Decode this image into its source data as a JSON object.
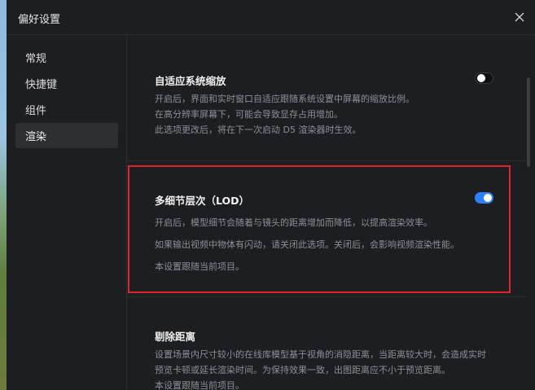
{
  "window": {
    "title": "偏好设置"
  },
  "sidebar": {
    "items": [
      {
        "label": "常规"
      },
      {
        "label": "快捷键"
      },
      {
        "label": "组件"
      },
      {
        "label": "渲染"
      }
    ]
  },
  "sections": {
    "adaptive_scaling": {
      "title": "自适应系统缩放",
      "desc": [
        "开启后，界面和实时窗口自适应跟随系统设置中屏幕的缩放比例。",
        "在高分辨率屏幕下，可能会导致显存占用增加。",
        "此选项更改后，将在下一次启动 D5 渲染器时生效。"
      ],
      "enabled": false
    },
    "lod": {
      "title": "多细节层次（LOD）",
      "desc": [
        "开启后，模型细节会随着与镜头的距离增加而降低，以提高渲染效率。",
        "如果输出视频中物体有闪动，请关闭此选项。关闭后，会影响视频渲染性能。",
        "本设置跟随当前项目。"
      ],
      "enabled": true
    },
    "culling": {
      "title": "剔除距离",
      "desc": [
        "设置场景内尺寸较小的在线库模型基于视角的消隐距离，当距离较大时，会造成实时",
        "预览卡顿或延长渲染时间。为保持效果一致，出图距离应不小于预览距离。",
        "本设置跟随当前项目。"
      ]
    }
  },
  "colors": {
    "accent": "#2f7ff5",
    "highlight_border": "#e0232f"
  }
}
